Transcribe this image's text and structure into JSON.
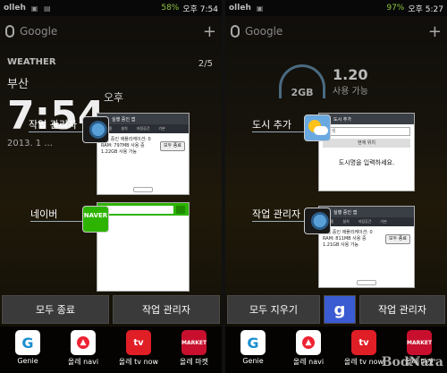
{
  "left": {
    "status": {
      "carrier": "olleh",
      "battery": "58%",
      "time": "오후 7:54"
    },
    "search": {
      "placeholder": "Google"
    },
    "weather": {
      "brand": "WEATHER",
      "city": "부산",
      "clock": "7:54",
      "ampm": "오후",
      "page": "2/5",
      "date": "2013. 1 ..."
    },
    "recent": [
      {
        "label": "작업 관리자",
        "app": "task-manager",
        "preview_title": "실행 중인 앱",
        "preview_lines": [
          "실행 중인 애플리케이션: 0",
          "RAM: 797MB 사용 중",
          "1.22GB 사용 가능"
        ],
        "preview_button": "모두 종료"
      },
      {
        "label": "네이버",
        "app": "naver",
        "preview_title": "NAVER"
      }
    ],
    "actions": {
      "close_all": "모두 종료",
      "task_manager": "작업 관리자"
    }
  },
  "right": {
    "status": {
      "carrier": "olleh",
      "battery": "97%",
      "time": "오후 5:27"
    },
    "search": {
      "placeholder": "Google"
    },
    "data_widget": {
      "gauge": "2GB",
      "amount": "1.20",
      "unit": "사용 가능"
    },
    "recent": [
      {
        "label": "도시 추가",
        "app": "weather",
        "preview_title": "도시 추가",
        "search_placeholder": "검색",
        "current_location": "현재 위치",
        "message": "도시명을 입력하세요."
      },
      {
        "label": "작업 관리자",
        "app": "task-manager",
        "preview_title": "실행 중인 앱",
        "preview_lines": [
          "실행 중인 애플리케이션: 0",
          "RAM: 811MB 사용 중",
          "1.21GB 사용 가능"
        ],
        "preview_button": "모두 종료"
      }
    ],
    "actions": {
      "clear_all": "모두 지우기",
      "task_manager": "작업 관리자"
    }
  },
  "dock_left": [
    {
      "label": "Genie"
    },
    {
      "label": "올레 navi"
    },
    {
      "label": "올레 tv now"
    },
    {
      "label": "올레 마켓"
    }
  ],
  "dock_right": [
    {
      "label": "Genie"
    },
    {
      "label": "올레 navi"
    },
    {
      "label": "올레 tv now"
    },
    {
      "label": "올레 마켓"
    }
  ],
  "watermark": "BodNara"
}
